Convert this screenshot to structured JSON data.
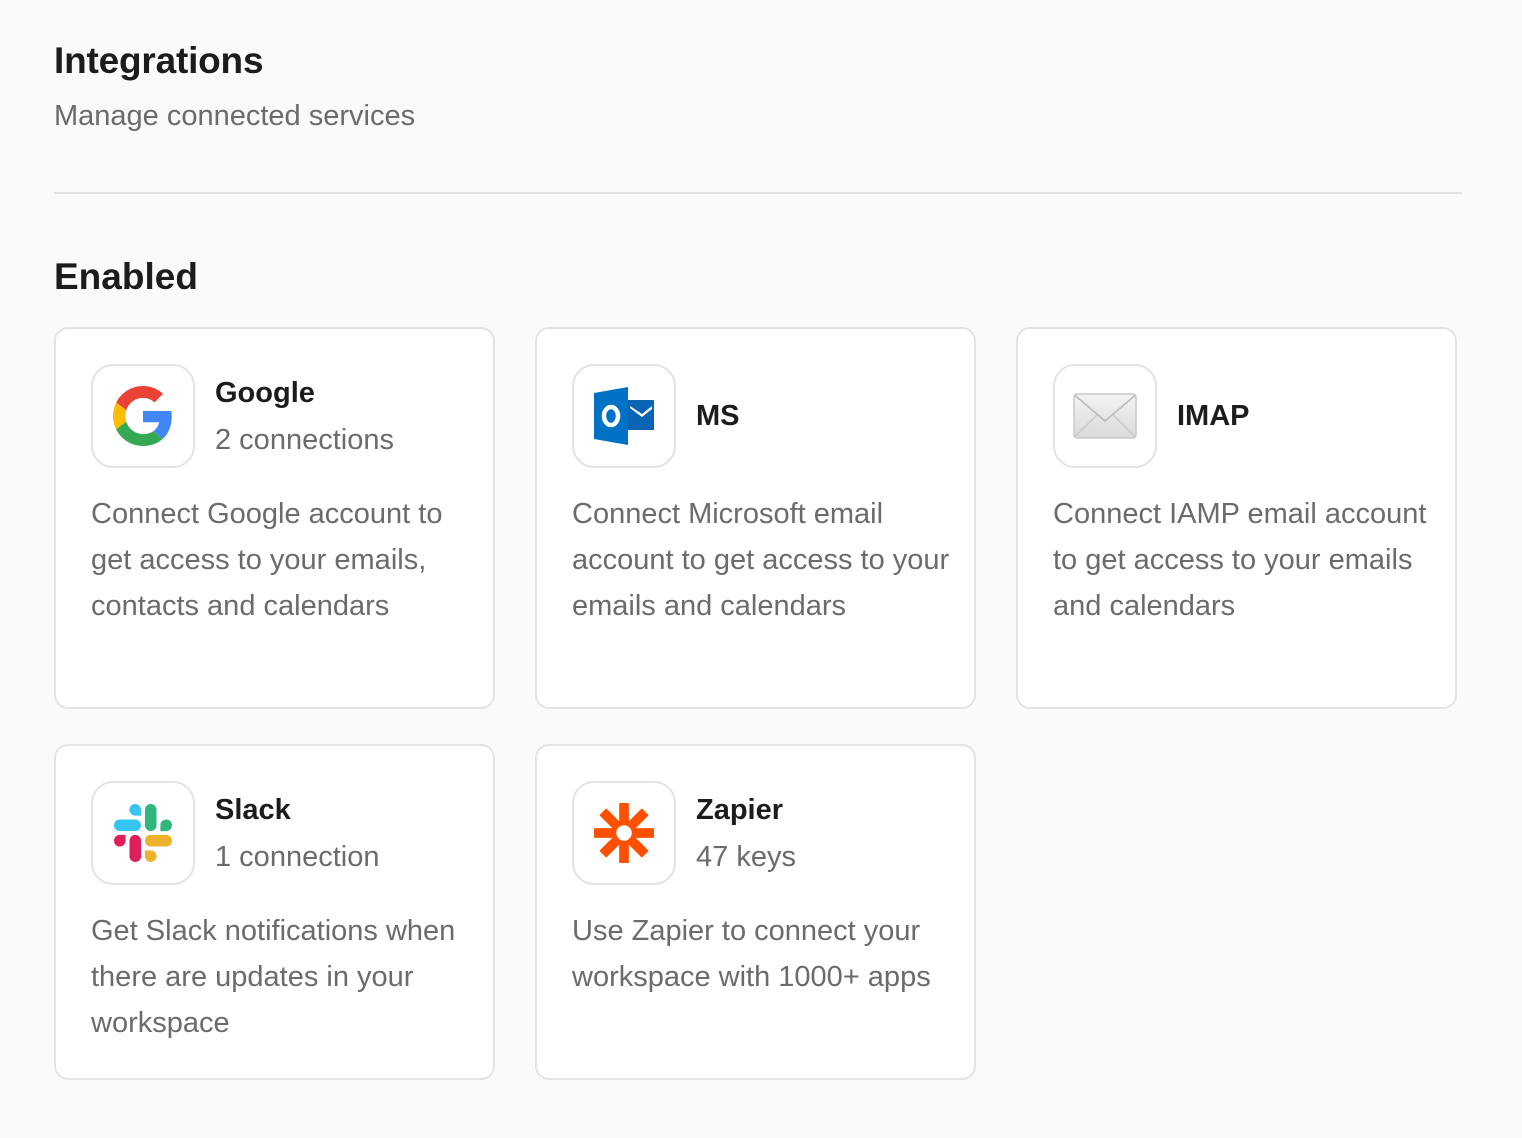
{
  "header": {
    "title": "Integrations",
    "subtitle": "Manage connected services"
  },
  "section": {
    "title": "Enabled"
  },
  "integrations": [
    {
      "name": "Google",
      "meta": "2 connections",
      "description": "Connect Google account to get access to your emails, contacts and calendars",
      "icon": "google-logo-icon"
    },
    {
      "name": "MS",
      "meta": "",
      "description": "Connect Microsoft email account to get access to your emails and calendars",
      "icon": "outlook-logo-icon"
    },
    {
      "name": "IMAP",
      "meta": "",
      "description": "Connect IAMP email account to get access to your emails and calendars",
      "icon": "envelope-icon"
    },
    {
      "name": "Slack",
      "meta": "1 connection",
      "description": "Get Slack notifications when there are updates in your workspace",
      "icon": "slack-logo-icon"
    },
    {
      "name": "Zapier",
      "meta": "47 keys",
      "description": "Use Zapier to connect your workspace with 1000+ apps",
      "icon": "zapier-logo-icon"
    }
  ],
  "colors": {
    "background": "#fafafa",
    "card_border": "#e3e3e3",
    "title_text": "#1c1c1c",
    "secondary_text": "#6b6b6b",
    "google_blue": "#4285f4",
    "google_red": "#ea4335",
    "google_yellow": "#fbbc05",
    "google_green": "#34a853",
    "outlook_blue": "#0072c6",
    "slack_blue": "#36c5f0",
    "slack_green": "#2eb67d",
    "slack_yellow": "#ecb22e",
    "slack_red": "#e01e5a",
    "zapier_orange": "#ff4f00"
  }
}
